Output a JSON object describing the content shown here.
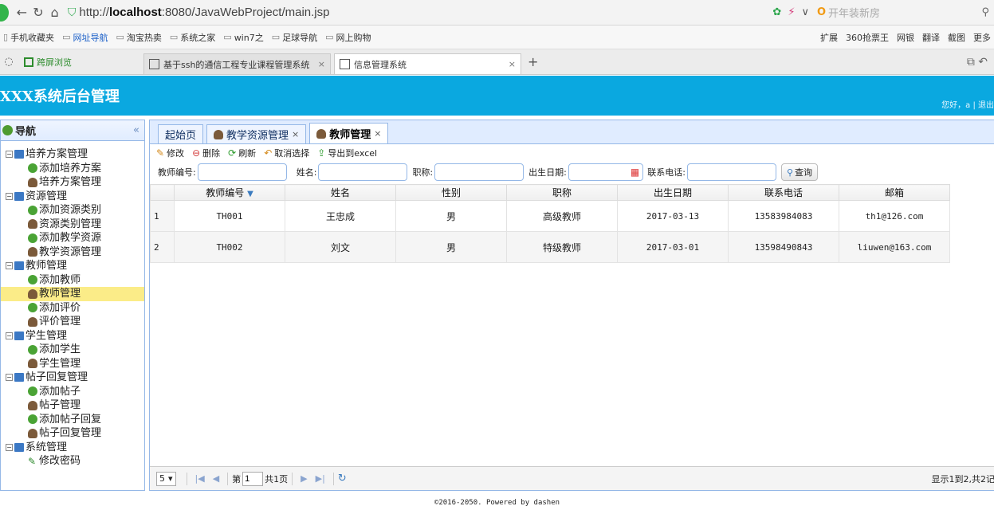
{
  "browser": {
    "url_prefix": "http://",
    "url_host": "localhost",
    "url_path": ":8080/JavaWebProject/main.jsp",
    "search_placeholder": "开年装新房",
    "favorites": [
      "手机收藏夹",
      "网址导航",
      "淘宝热卖",
      "系统之家",
      "win7之",
      "足球导航",
      "网上购物"
    ],
    "favorites_right": [
      "扩展",
      "360抢票王",
      "网银",
      "翻译",
      "截图",
      "更多"
    ],
    "split_view": "跨屏浏览",
    "tabs": [
      "基于ssh的通信工程专业课程管理系统",
      "信息管理系统"
    ]
  },
  "header": {
    "title": "XXX系统后台管理",
    "user_text": "您好，a | 退出"
  },
  "sidebar": {
    "title": "导航",
    "collapse_icon": "«",
    "groups": [
      {
        "label": "培养方案管理",
        "items": [
          "添加培养方案",
          "培养方案管理"
        ]
      },
      {
        "label": "资源管理",
        "items": [
          "添加资源类别",
          "资源类别管理",
          "添加教学资源",
          "教学资源管理"
        ]
      },
      {
        "label": "教师管理",
        "items": [
          "添加教师",
          "教师管理",
          "添加评价",
          "评价管理"
        ]
      },
      {
        "label": "学生管理",
        "items": [
          "添加学生",
          "学生管理"
        ]
      },
      {
        "label": "帖子回复管理",
        "items": [
          "添加帖子",
          "帖子管理",
          "添加帖子回复",
          "帖子回复管理"
        ]
      },
      {
        "label": "系统管理",
        "items": [
          "修改密码"
        ]
      }
    ],
    "selected": "教师管理"
  },
  "content_tabs": [
    {
      "label": "起始页",
      "closable": false
    },
    {
      "label": "教学资源管理",
      "closable": true
    },
    {
      "label": "教师管理",
      "closable": true,
      "active": true
    }
  ],
  "toolbar": {
    "edit": "修改",
    "delete": "删除",
    "refresh": "刷新",
    "unselect": "取消选择",
    "export": "导出到excel"
  },
  "filter": {
    "teacher_no_label": "教师编号:",
    "name_label": "姓名:",
    "title_label": "职称:",
    "birth_label": "出生日期:",
    "phone_label": "联系电话:",
    "query_button": "查询"
  },
  "table": {
    "columns": [
      "教师编号",
      "姓名",
      "性别",
      "职称",
      "出生日期",
      "联系电话",
      "邮箱"
    ],
    "rows": [
      {
        "index": "1",
        "cells": [
          "TH001",
          "王忠成",
          "男",
          "高级教师",
          "2017-03-13",
          "13583984083",
          "th1@126.com"
        ]
      },
      {
        "index": "2",
        "cells": [
          "TH002",
          "刘文",
          "男",
          "特级教师",
          "2017-03-01",
          "13598490843",
          "liuwen@163.com"
        ]
      }
    ]
  },
  "pager": {
    "page_size": "5",
    "page_prefix": "第",
    "page_value": "1",
    "page_suffix": "共1页",
    "info": "显示1到2,共2记"
  },
  "footer": "©2016-2050. Powered by dashen",
  "colors": {
    "header_bg": "#0aa8e0",
    "panel_border": "#95b8e7",
    "selected_bg": "#fbec88"
  }
}
